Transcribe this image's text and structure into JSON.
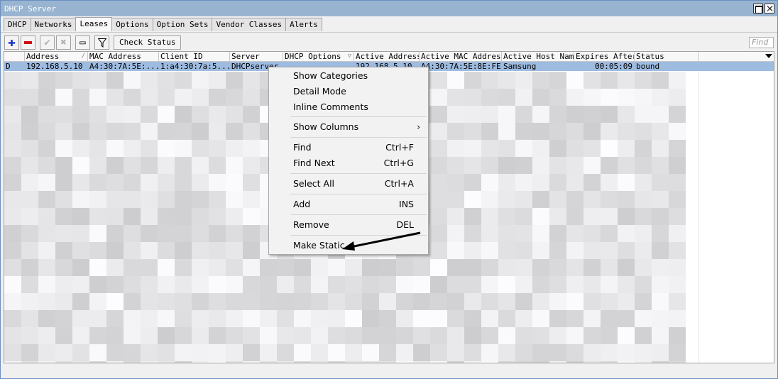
{
  "window": {
    "title": "DHCP Server"
  },
  "tabs": [
    "DHCP",
    "Networks",
    "Leases",
    "Options",
    "Option Sets",
    "Vendor Classes",
    "Alerts"
  ],
  "active_tab": "Leases",
  "toolbar": {
    "check_status_label": "Check Status",
    "find_placeholder": "Find"
  },
  "columns": [
    "Address",
    "MAC Address",
    "Client ID",
    "Server",
    "DHCP Options",
    "Active Address",
    "Active MAC Address",
    "Active Host Name",
    "Expires After",
    "Status"
  ],
  "selected_row": {
    "flag": "D",
    "address": "192.168.5.10",
    "mac_address": "A4:30:7A:5E:...",
    "client_id": "1:a4:30:7a:5...",
    "server": "DHCPserver",
    "dhcp_options": "",
    "active_address": "192.168.5.10",
    "active_mac_address": "A4:30:7A:5E:8E:FE",
    "active_host_name": "Samsung",
    "expires_after": "00:05:09",
    "status": "bound"
  },
  "context_menu": {
    "show_categories": "Show Categories",
    "detail_mode": "Detail Mode",
    "inline_comments": "Inline Comments",
    "show_columns": "Show Columns",
    "find": "Find",
    "find_shortcut": "Ctrl+F",
    "find_next": "Find Next",
    "find_next_shortcut": "Ctrl+G",
    "select_all": "Select All",
    "select_all_shortcut": "Ctrl+A",
    "add": "Add",
    "add_shortcut": "INS",
    "remove": "Remove",
    "remove_shortcut": "DEL",
    "make_static": "Make Static"
  },
  "colors": {
    "titlebar": "#99b4d1",
    "selected_row": "#9ebbe0",
    "add_icon": "#1433c8",
    "remove_icon": "#d01010"
  }
}
